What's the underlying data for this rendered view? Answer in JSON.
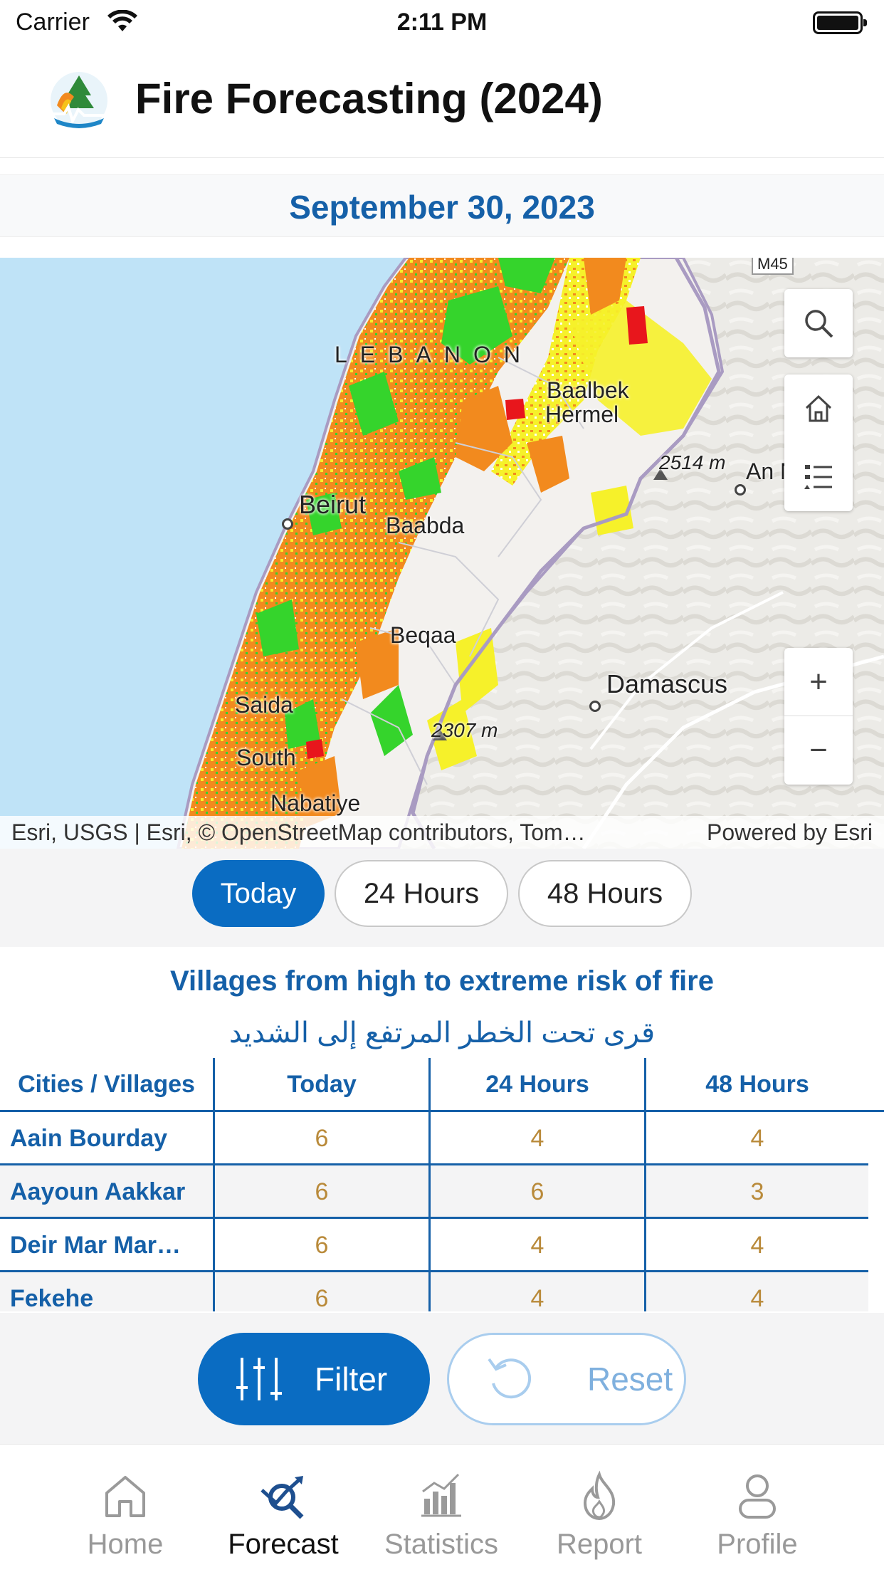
{
  "status_bar": {
    "carrier": "Carrier",
    "time": "2:11 PM"
  },
  "header": {
    "title": "Fire Forecasting (2024)"
  },
  "date": "September 30, 2023",
  "map": {
    "labels": {
      "country": "LEBANON",
      "baalbek": "Baalbek",
      "hermel": "Hermel",
      "beirut": "Beirut",
      "baabda": "Baabda",
      "beqaa": "Beqaa",
      "damascus": "Damascus",
      "south": "South",
      "saida": "Saida",
      "nabatiye": "Nabatiye",
      "peak1": "2514 m",
      "peak2": "2307 m",
      "an_nabk": "An Nabk",
      "highway": "M45"
    },
    "attribution": "Esri, USGS | Esri, © OpenStreetMap contributors, Tom…",
    "powered_by": "Powered by Esri",
    "controls": {
      "search": "search-icon",
      "home": "home-icon",
      "legend": "legend-list-icon",
      "zoom_in": "+",
      "zoom_out": "−"
    }
  },
  "segments": {
    "today": "Today",
    "h24": "24 Hours",
    "h48": "48 Hours",
    "active": "Today"
  },
  "villages": {
    "title": "Villages from high to extreme risk of fire",
    "title_ar": "قرى تحت الخطر المرتفع إلى الشديد",
    "columns": {
      "name": "Cities / Villages",
      "today": "Today",
      "h24": "24 Hours",
      "h48": "48 Hours"
    },
    "rows": [
      {
        "name": "Aain Bourday",
        "today": "6",
        "h24": "4",
        "h48": "4"
      },
      {
        "name": "Aayoun Aakkar",
        "today": "6",
        "h24": "6",
        "h48": "3"
      },
      {
        "name": "Deir Mar Mar…",
        "today": "6",
        "h24": "4",
        "h48": "4"
      },
      {
        "name": "Fekehe",
        "today": "6",
        "h24": "4",
        "h48": "4"
      }
    ]
  },
  "actions": {
    "filter": "Filter",
    "reset": "Reset"
  },
  "tabs": [
    {
      "label": "Home",
      "icon": "home-icon",
      "active": false
    },
    {
      "label": "Forecast",
      "icon": "forecast-icon",
      "active": true
    },
    {
      "label": "Statistics",
      "icon": "statistics-icon",
      "active": false
    },
    {
      "label": "Report",
      "icon": "flame-icon",
      "active": false
    },
    {
      "label": "Profile",
      "icon": "person-icon",
      "active": false
    }
  ],
  "colors": {
    "primary": "#0a6cc2",
    "title_blue": "#1560a8",
    "risk_green": "#35d42c",
    "risk_yellow": "#f6f12a",
    "risk_orange": "#f28a1e",
    "risk_red": "#e8161c",
    "sea": "#bfe3f7"
  }
}
